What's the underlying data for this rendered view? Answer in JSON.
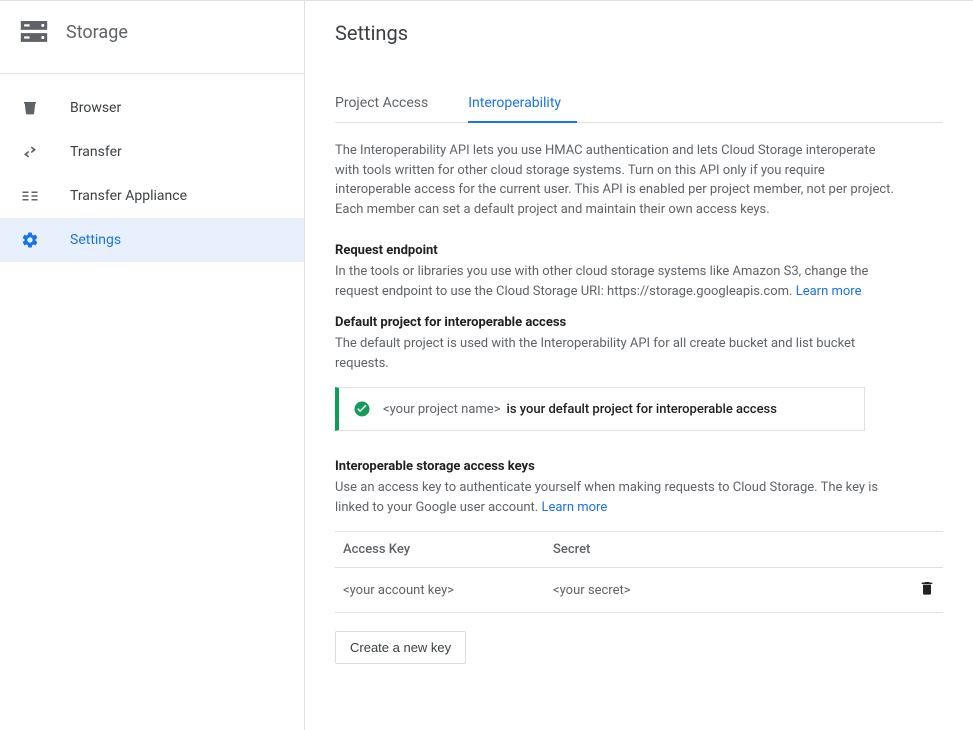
{
  "sidebar": {
    "title": "Storage",
    "items": [
      {
        "label": "Browser"
      },
      {
        "label": "Transfer"
      },
      {
        "label": "Transfer Appliance"
      },
      {
        "label": "Settings"
      }
    ]
  },
  "page": {
    "title": "Settings",
    "tabs": [
      {
        "label": "Project Access",
        "active": false
      },
      {
        "label": "Interoperability",
        "active": true
      }
    ],
    "intro": "The Interoperability API lets you use HMAC authentication and lets Cloud Storage interoperate with tools written for other cloud storage systems. Turn on this API only if you require interoperable access for the current user. This API is enabled per project member, not per project. Each member can set a default project and maintain their own access keys.",
    "endpoint": {
      "title": "Request endpoint",
      "desc_prefix": "In the tools or libraries you use with other cloud storage systems like Amazon S3, change the request endpoint to use the Cloud Storage URI: https://storage.googleapis.com. ",
      "learn_more": "Learn more"
    },
    "default_project": {
      "title": "Default project for interoperable access",
      "desc": "The default project is used with the Interoperability API for all create bucket and list bucket requests.",
      "project_placeholder": "<your project name>",
      "msg": " is your default project for interoperable access"
    },
    "keys": {
      "title": "Interoperable storage access keys",
      "desc_prefix": "Use an access key to authenticate yourself when making requests to Cloud Storage. The key is linked to your Google user account. ",
      "learn_more": "Learn more",
      "col_key": "Access Key",
      "col_secret": "Secret",
      "rows": [
        {
          "key": "<your account key>",
          "secret": "<your secret>"
        }
      ],
      "create_btn": "Create a new key"
    }
  }
}
